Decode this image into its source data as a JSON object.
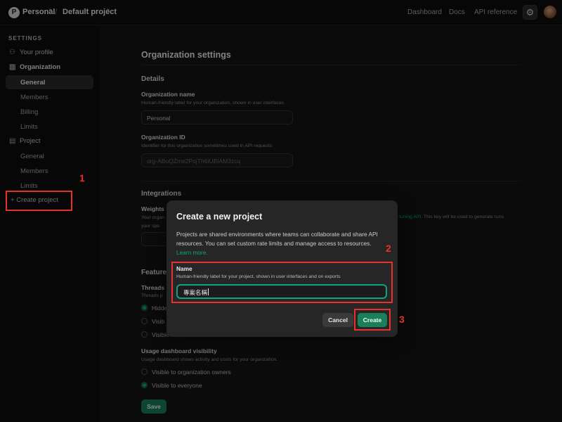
{
  "topbar": {
    "logo_letter": "P",
    "org_name": "Personal",
    "project_name": "Default project",
    "chevron": "⌃",
    "separator": "/",
    "nav": [
      "Dashboard",
      "Docs",
      "API reference"
    ],
    "settings_icon": "gear-icon"
  },
  "sidebar": {
    "heading": "SETTINGS",
    "your_profile": "Your profile",
    "organization": "Organization",
    "org_items": [
      "General",
      "Members",
      "Billing",
      "Limits"
    ],
    "project": "Project",
    "project_items": [
      "General",
      "Members",
      "Limits"
    ],
    "create_project": "Create project"
  },
  "main": {
    "title": "Organization settings",
    "details_heading": "Details",
    "org_name_label": "Organization name",
    "org_name_help": "Human-friendly label for your organization, shown in user interfaces",
    "org_name_value": "Personal",
    "org_id_label": "Organization ID",
    "org_id_help": "Identifier for this organization sometimes used in API requests",
    "org_id_value": "org-ABoQZme2PojTh6lUBIAM3zcq",
    "integrations_heading": "Integrations",
    "weights_label_fragment": "Weights",
    "weights_help_fragment": "Your organ",
    "weights_help_fragment2": "your spe",
    "weights_help_link": "-tuning API",
    "weights_help_tail": ". This key will be used to generate runs",
    "weights_help_tail2": "in your spe",
    "features_heading_fragment": "Feature",
    "threads_label_fragment": "Threads",
    "threads_help_fragment": "Threads p",
    "threads_options": [
      "Hidde",
      "Visib",
      "Visible"
    ],
    "usage_label": "Usage dashboard visibility",
    "usage_help": "Usage dashboard shows activity and costs for your organization.",
    "usage_options": [
      "Visible to organization owners",
      "Visible to everyone"
    ],
    "save_label": "Save"
  },
  "modal": {
    "title": "Create a new project",
    "description": "Projects are shared environments where teams can collaborate and share API resources. You can set custom rate limits and manage access to resources.",
    "learn_more": "Learn more.",
    "name_label": "Name",
    "name_help": "Human-friendly label for your project, shown in user interfaces and on exports",
    "name_value": "專案名稱",
    "cancel_label": "Cancel",
    "create_label": "Create"
  },
  "annotations": [
    "1",
    "2",
    "3"
  ],
  "colors": {
    "accent": "#10a37f",
    "button_green": "#1a7f5a",
    "annotation_red": "#e8312a"
  }
}
